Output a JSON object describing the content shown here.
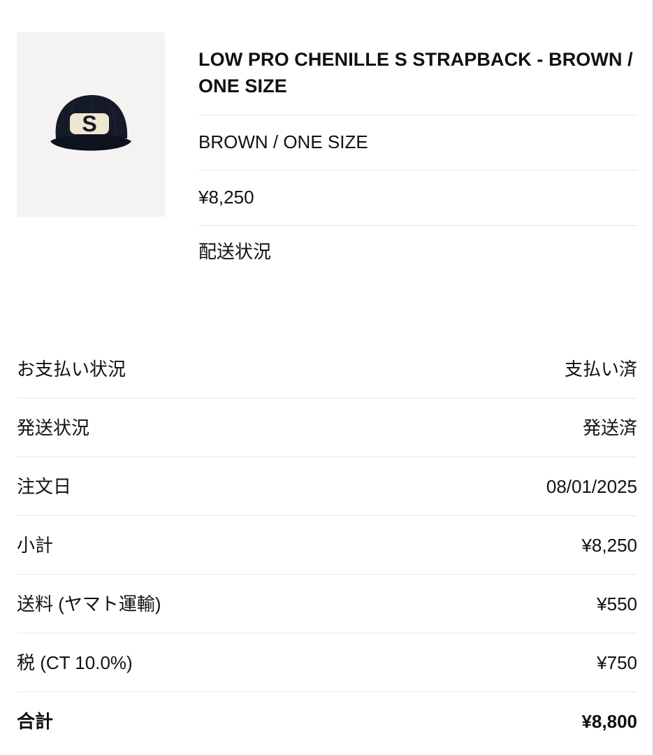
{
  "product": {
    "image_icon": "cap-icon",
    "title": "LOW PRO CHENILLE S STRAPBACK - BROWN / ONE SIZE",
    "variant": "BROWN / ONE SIZE",
    "price": "¥8,250",
    "shipping_status_link": "配送状況",
    "logo_letter": "S"
  },
  "summary": [
    {
      "label": "お支払い状況",
      "value": "支払い済"
    },
    {
      "label": "発送状況",
      "value": "発送済"
    },
    {
      "label": "注文日",
      "value": "08/01/2025"
    },
    {
      "label": "小計",
      "value": "¥8,250"
    },
    {
      "label": "送料 (ヤマト運輸)",
      "value": "¥550"
    },
    {
      "label": "税 (CT 10.0%)",
      "value": "¥750"
    },
    {
      "label": "合計",
      "value": "¥8,800"
    }
  ],
  "colors": {
    "cap_body": "#141a27",
    "logo_fill": "#efe6d2",
    "divider": "#e6e6e6"
  }
}
